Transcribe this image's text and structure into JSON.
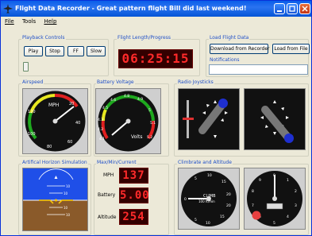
{
  "window": {
    "title": "Flight Data Recorder - Great pattern flight Bill did last weekend!"
  },
  "menu": {
    "file": "File",
    "tools": "Tools",
    "help": "Help"
  },
  "playback": {
    "label": "Playback Controls",
    "play": "Play",
    "stop": "Stop",
    "ff": "FF",
    "slow": "Slow"
  },
  "flight_length": {
    "label": "Flight Length/Progress",
    "value": "06:25:15"
  },
  "load": {
    "label": "Load Flight Data",
    "download": "Download from Recorder",
    "from_file": "Load from File"
  },
  "notifications": {
    "label": "Notifications",
    "text": ""
  },
  "airspeed": {
    "label": "Airspeed",
    "unit": "MPH",
    "ticks": [
      "20",
      "40",
      "60",
      "80",
      "100",
      "120"
    ]
  },
  "battery": {
    "label": "Battery Voltage",
    "unit": "Volts",
    "ticks": [
      "4.1",
      "4.2",
      "4.3",
      "4.5",
      "4.6",
      "4.8",
      "4.9",
      "5",
      "5.1",
      "5.2"
    ]
  },
  "radio": {
    "label": "Radio Joysticks"
  },
  "horizon": {
    "label": "Artifical Horizon Simulation",
    "ticks": [
      "10",
      "10",
      "10",
      "10"
    ]
  },
  "maxmin": {
    "label": "Max/Min/Current",
    "mph_label": "MPH",
    "mph": "137",
    "battery_label": "Battery",
    "battery": "5.00",
    "altitude_label": "Altitude",
    "altitude": "254"
  },
  "climb": {
    "label": "Climbrate and Altitude",
    "gauge_label": "CLIMB",
    "gauge_unit": "100 ft/min",
    "ticks": [
      "5",
      "10",
      "15",
      "20",
      "5",
      "10",
      "15",
      "20",
      "0"
    ]
  },
  "altimeter": {
    "ticks": [
      "0",
      "1",
      "2",
      "3",
      "4",
      "5",
      "6",
      "7",
      "8",
      "9"
    ]
  }
}
